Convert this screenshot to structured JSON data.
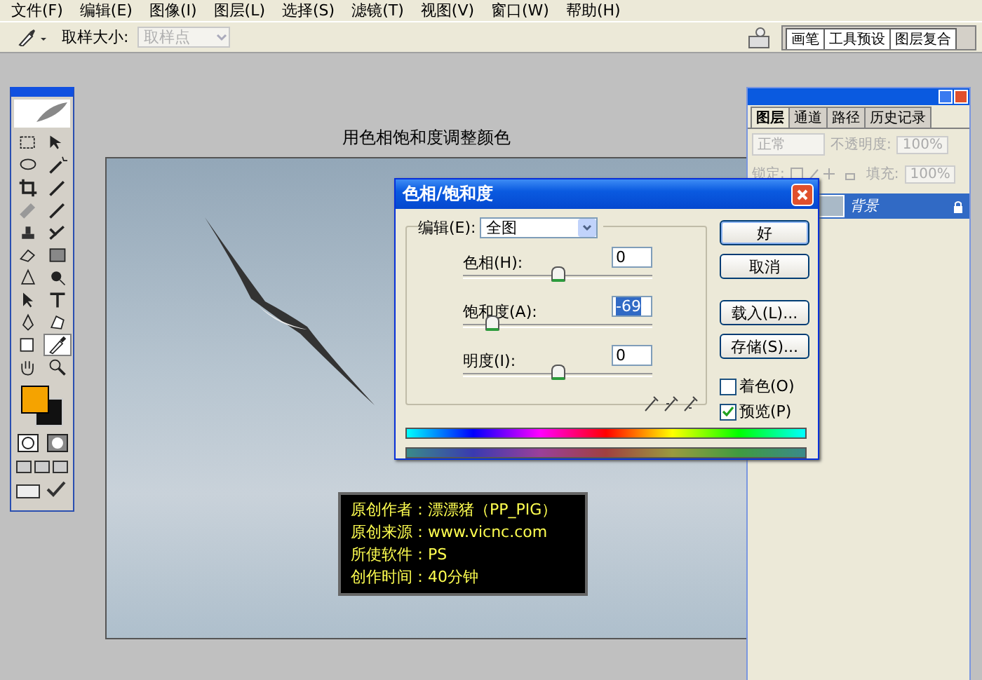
{
  "menu_bar": {
    "items": [
      "文件(F)",
      "编辑(E)",
      "图像(I)",
      "图层(L)",
      "选择(S)",
      "滤镜(T)",
      "视图(V)",
      "窗口(W)",
      "帮助(H)"
    ]
  },
  "options_bar": {
    "label": "取样大小:",
    "dropdown": {
      "value": "取样点",
      "disabled": true
    }
  },
  "palette_well": {
    "tabs": [
      "画笔",
      "工具预设",
      "图层复合"
    ]
  },
  "document": {
    "title": "用色相饱和度调整颜色",
    "info_lines": [
      {
        "label": "原创作者：",
        "value": "漂漂猪（PP_PIG）"
      },
      {
        "label": "原创来源：",
        "value": "www.vicnc.com"
      },
      {
        "label": "所使软件：",
        "value": "PS"
      },
      {
        "label": "创作时间：",
        "value": "40分钟"
      }
    ]
  },
  "dialog": {
    "title": "色相/饱和度",
    "edit_label": "编辑(E):",
    "edit_value": "全图",
    "sliders": [
      {
        "label": "色相(H):",
        "value": "0",
        "level": 0.5,
        "selected": false
      },
      {
        "label": "饱和度(A):",
        "value": "-69",
        "level": 0.155,
        "selected": true
      },
      {
        "label": "明度(I):",
        "value": "0",
        "level": 0.5,
        "selected": false
      }
    ],
    "buttons": [
      {
        "label": "好",
        "default": true
      },
      {
        "label": "取消",
        "default": false
      },
      {
        "label": "载入(L)...",
        "default": false
      },
      {
        "label": "存储(S)...",
        "default": false
      }
    ],
    "checkboxes": [
      {
        "label": "着色(O)",
        "checked": false
      },
      {
        "label": "预览(P)",
        "checked": true
      }
    ]
  },
  "layers_panel": {
    "tabs": [
      {
        "label": "图层",
        "selected": true
      },
      {
        "label": "通道",
        "selected": false
      },
      {
        "label": "路径",
        "selected": false
      },
      {
        "label": "历史记录",
        "selected": false
      }
    ],
    "blend_mode": "正常",
    "opacity_label": "不透明度:",
    "opacity": "100%",
    "lock_label": "锁定:",
    "fill_label": "填充:",
    "fill": "100%",
    "layers": [
      {
        "name": "背景",
        "selected": true,
        "locked": true
      }
    ]
  }
}
